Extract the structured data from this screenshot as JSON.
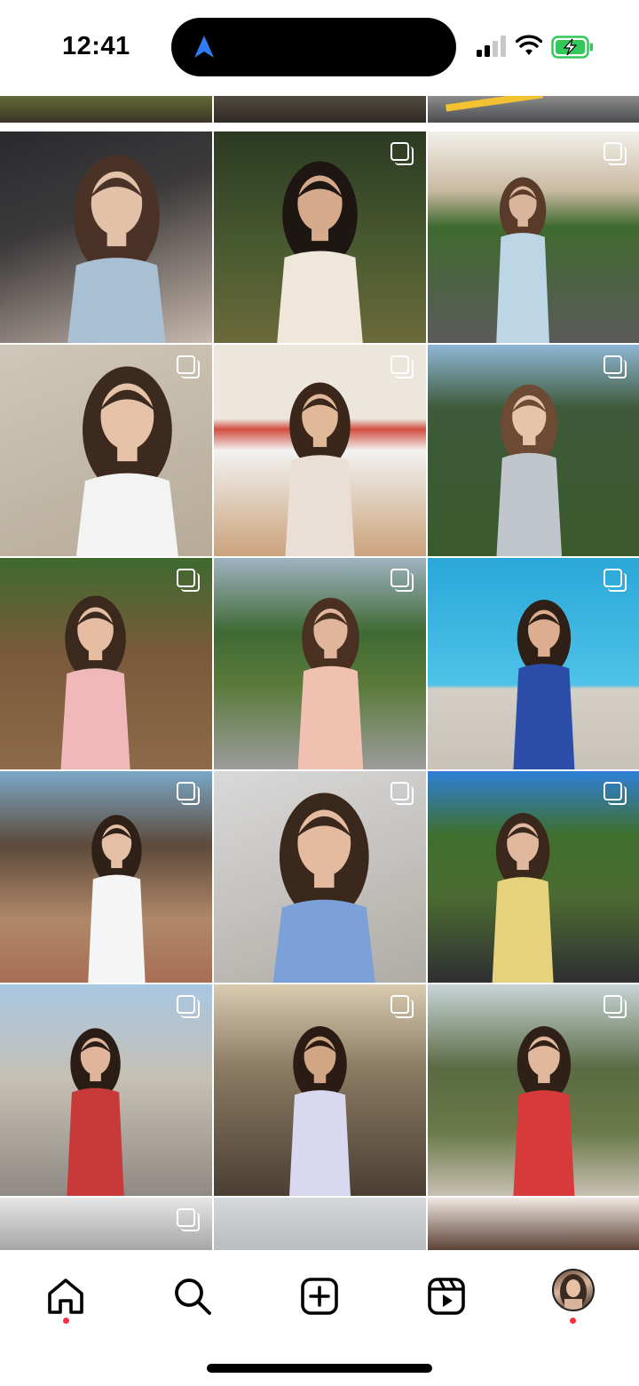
{
  "status_bar": {
    "time": "12:41",
    "icons": [
      "location-arrow-icon",
      "cellular-signal-icon",
      "wifi-icon",
      "battery-charging-icon"
    ],
    "colors": {
      "location_arrow": "#2f7cf6",
      "battery": "#34c759"
    }
  },
  "profile_grid": {
    "posts": [
      {
        "id": "partial-top-1",
        "multi": false
      },
      {
        "id": "partial-top-2",
        "multi": false
      },
      {
        "id": "partial-top-3",
        "multi": false
      },
      {
        "id": "car-selfie",
        "multi": false
      },
      {
        "id": "white-dress-outdoor",
        "multi": true
      },
      {
        "id": "path-walk",
        "multi": true
      },
      {
        "id": "closeup-selfie",
        "multi": true
      },
      {
        "id": "burger-restaurant",
        "multi": true
      },
      {
        "id": "puppy-field",
        "multi": true
      },
      {
        "id": "porch-bench",
        "multi": true
      },
      {
        "id": "bicycle",
        "multi": true
      },
      {
        "id": "pool",
        "multi": true
      },
      {
        "id": "storefront",
        "multi": true
      },
      {
        "id": "lying-selfie",
        "multi": true
      },
      {
        "id": "parking-lot",
        "multi": true
      },
      {
        "id": "street-bench",
        "multi": true
      },
      {
        "id": "beach-waves",
        "multi": true
      },
      {
        "id": "palm-tree",
        "multi": true
      },
      {
        "id": "partial-bottom-1",
        "multi": true
      },
      {
        "id": "partial-bottom-2",
        "multi": false
      },
      {
        "id": "partial-bottom-3",
        "multi": false
      }
    ]
  },
  "bottom_nav": {
    "items": [
      {
        "name": "home",
        "icon": "home-icon",
        "has_dot": true
      },
      {
        "name": "search",
        "icon": "search-icon",
        "has_dot": false
      },
      {
        "name": "create",
        "icon": "plus-square-icon",
        "has_dot": false
      },
      {
        "name": "reels",
        "icon": "reels-icon",
        "has_dot": false
      },
      {
        "name": "profile",
        "icon": "profile-avatar",
        "has_dot": true
      }
    ],
    "dot_color": "#ff3040"
  }
}
